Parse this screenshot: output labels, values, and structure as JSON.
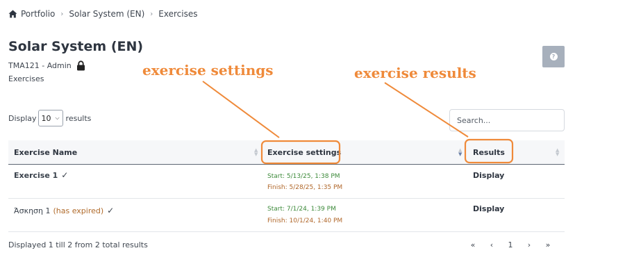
{
  "breadcrumb": {
    "home_icon": "home-icon",
    "items": [
      "Portfolio",
      "Solar System (EN)",
      "Exercises"
    ],
    "separator": "›"
  },
  "header": {
    "title": "Solar System (EN)",
    "course_code": "TMA121 - Admin",
    "lock_icon": "lock-icon",
    "section": "Exercises"
  },
  "help_button": {
    "icon": "question-icon",
    "glyph": "?"
  },
  "annotations": {
    "settings": "exercise settings",
    "results": "exercise results",
    "color": "#ef8a3a"
  },
  "controls": {
    "display_prefix": "Display",
    "page_size": "10",
    "display_suffix": "results",
    "search_placeholder": "Search..."
  },
  "table": {
    "columns": [
      "Exercise Name",
      "Exercise settings",
      "Results"
    ],
    "rows": [
      {
        "name": "Exercise 1",
        "status": "",
        "check": "✓",
        "start": "Start: 5/13/25, 1:38 PM",
        "finish": "Finish: 5/28/25, 1:35 PM",
        "results": "Display"
      },
      {
        "name": "Άσκηση 1",
        "status": "(has expired)",
        "check": "✓",
        "start": "Start: 7/1/24, 1:39 PM",
        "finish": "Finish: 10/1/24, 1:40 PM",
        "results": "Display"
      }
    ]
  },
  "footer": {
    "summary": "Displayed 1 till 2 from 2 total results",
    "pagination": {
      "first": "«",
      "prev": "‹",
      "current": "1",
      "next": "›",
      "last": "»"
    }
  },
  "colors": {
    "start_text": "#3d8a3a",
    "finish_text": "#b0672a",
    "help_button": "#a7b0bc"
  }
}
